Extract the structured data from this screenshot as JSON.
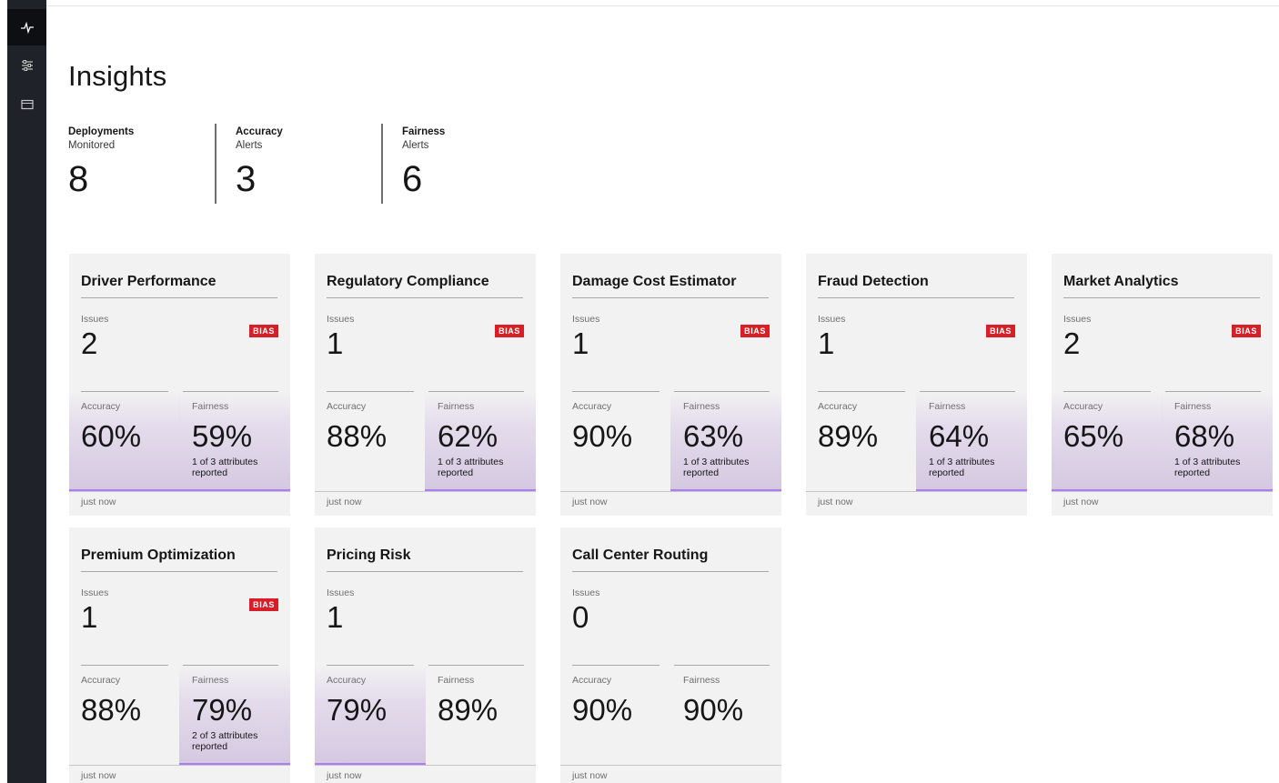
{
  "sidebar": {
    "items": [
      {
        "icon": "activity-icon",
        "active": true
      },
      {
        "icon": "list-settings-icon",
        "active": false
      },
      {
        "icon": "monitor-icon",
        "active": false
      }
    ]
  },
  "header": {
    "title": "Insights"
  },
  "summary": [
    {
      "label": "Deployments",
      "sub": "Monitored",
      "value": "8"
    },
    {
      "label": "Accuracy",
      "sub": "Alerts",
      "value": "3"
    },
    {
      "label": "Fairness",
      "sub": "Alerts",
      "value": "6"
    }
  ],
  "labels": {
    "issues": "Issues",
    "accuracy": "Accuracy",
    "fairness": "Fairness",
    "bias": "BIAS"
  },
  "colors": {
    "sidebar": "#1f2228",
    "bias_badge": "#da1e28",
    "alert_gradient": "#d4c8e0",
    "card_bg": "#f2f2f2"
  },
  "cards": [
    {
      "title": "Driver Performance",
      "issues": "2",
      "bias": true,
      "accuracy": "60%",
      "accuracy_alert": true,
      "fairness": "59%",
      "fairness_alert": true,
      "fairness_note": "1 of 3 attributes reported",
      "time": "just now"
    },
    {
      "title": "Regulatory Compliance",
      "issues": "1",
      "bias": true,
      "accuracy": "88%",
      "accuracy_alert": false,
      "fairness": "62%",
      "fairness_alert": true,
      "fairness_note": "1 of 3 attributes reported",
      "time": "just now"
    },
    {
      "title": "Damage Cost Estimator",
      "issues": "1",
      "bias": true,
      "accuracy": "90%",
      "accuracy_alert": false,
      "fairness": "63%",
      "fairness_alert": true,
      "fairness_note": "1 of 3 attributes reported",
      "time": "just now"
    },
    {
      "title": "Fraud Detection",
      "issues": "1",
      "bias": true,
      "accuracy": "89%",
      "accuracy_alert": false,
      "fairness": "64%",
      "fairness_alert": true,
      "fairness_note": "1 of 3 attributes reported",
      "time": "just now"
    },
    {
      "title": "Market Analytics",
      "issues": "2",
      "bias": true,
      "accuracy": "65%",
      "accuracy_alert": true,
      "fairness": "68%",
      "fairness_alert": true,
      "fairness_note": "1 of 3 attributes reported",
      "time": "just now"
    },
    {
      "title": "Premium Optimization",
      "issues": "1",
      "bias": true,
      "accuracy": "88%",
      "accuracy_alert": false,
      "fairness": "79%",
      "fairness_alert": true,
      "fairness_note": "2 of 3 attributes reported",
      "time": "just now"
    },
    {
      "title": "Pricing Risk",
      "issues": "1",
      "bias": false,
      "accuracy": "79%",
      "accuracy_alert": true,
      "fairness": "89%",
      "fairness_alert": false,
      "fairness_note": "",
      "time": "just now"
    },
    {
      "title": "Call Center Routing",
      "issues": "0",
      "bias": false,
      "accuracy": "90%",
      "accuracy_alert": false,
      "fairness": "90%",
      "fairness_alert": false,
      "fairness_note": "",
      "time": "just now"
    }
  ]
}
